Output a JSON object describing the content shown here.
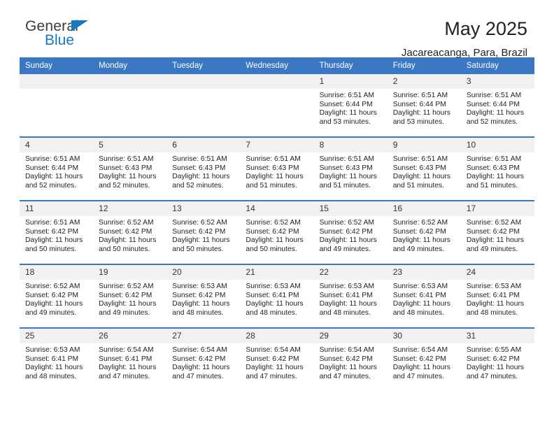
{
  "brand": {
    "name_part1": "General",
    "name_part2": "Blue",
    "flag_icon": "triangle-flag-icon",
    "accent_color": "#1878be"
  },
  "header": {
    "title": "May 2025",
    "subtitle": "Jacareacanga, Para, Brazil"
  },
  "theme": {
    "header_bg": "#3b78c3",
    "daynum_bg": "#f1f1f1",
    "row_rule": "#3b78c3",
    "text": "#232323"
  },
  "calendar": {
    "weekday_headers": [
      "Sunday",
      "Monday",
      "Tuesday",
      "Wednesday",
      "Thursday",
      "Friday",
      "Saturday"
    ],
    "weeks": [
      [
        {
          "day": "",
          "empty": true
        },
        {
          "day": "",
          "empty": true
        },
        {
          "day": "",
          "empty": true
        },
        {
          "day": "",
          "empty": true
        },
        {
          "day": "1",
          "sunrise": "Sunrise: 6:51 AM",
          "sunset": "Sunset: 6:44 PM",
          "daylight": "Daylight: 11 hours and 53 minutes."
        },
        {
          "day": "2",
          "sunrise": "Sunrise: 6:51 AM",
          "sunset": "Sunset: 6:44 PM",
          "daylight": "Daylight: 11 hours and 53 minutes."
        },
        {
          "day": "3",
          "sunrise": "Sunrise: 6:51 AM",
          "sunset": "Sunset: 6:44 PM",
          "daylight": "Daylight: 11 hours and 52 minutes."
        }
      ],
      [
        {
          "day": "4",
          "sunrise": "Sunrise: 6:51 AM",
          "sunset": "Sunset: 6:44 PM",
          "daylight": "Daylight: 11 hours and 52 minutes."
        },
        {
          "day": "5",
          "sunrise": "Sunrise: 6:51 AM",
          "sunset": "Sunset: 6:43 PM",
          "daylight": "Daylight: 11 hours and 52 minutes."
        },
        {
          "day": "6",
          "sunrise": "Sunrise: 6:51 AM",
          "sunset": "Sunset: 6:43 PM",
          "daylight": "Daylight: 11 hours and 52 minutes."
        },
        {
          "day": "7",
          "sunrise": "Sunrise: 6:51 AM",
          "sunset": "Sunset: 6:43 PM",
          "daylight": "Daylight: 11 hours and 51 minutes."
        },
        {
          "day": "8",
          "sunrise": "Sunrise: 6:51 AM",
          "sunset": "Sunset: 6:43 PM",
          "daylight": "Daylight: 11 hours and 51 minutes."
        },
        {
          "day": "9",
          "sunrise": "Sunrise: 6:51 AM",
          "sunset": "Sunset: 6:43 PM",
          "daylight": "Daylight: 11 hours and 51 minutes."
        },
        {
          "day": "10",
          "sunrise": "Sunrise: 6:51 AM",
          "sunset": "Sunset: 6:43 PM",
          "daylight": "Daylight: 11 hours and 51 minutes."
        }
      ],
      [
        {
          "day": "11",
          "sunrise": "Sunrise: 6:51 AM",
          "sunset": "Sunset: 6:42 PM",
          "daylight": "Daylight: 11 hours and 50 minutes."
        },
        {
          "day": "12",
          "sunrise": "Sunrise: 6:52 AM",
          "sunset": "Sunset: 6:42 PM",
          "daylight": "Daylight: 11 hours and 50 minutes."
        },
        {
          "day": "13",
          "sunrise": "Sunrise: 6:52 AM",
          "sunset": "Sunset: 6:42 PM",
          "daylight": "Daylight: 11 hours and 50 minutes."
        },
        {
          "day": "14",
          "sunrise": "Sunrise: 6:52 AM",
          "sunset": "Sunset: 6:42 PM",
          "daylight": "Daylight: 11 hours and 50 minutes."
        },
        {
          "day": "15",
          "sunrise": "Sunrise: 6:52 AM",
          "sunset": "Sunset: 6:42 PM",
          "daylight": "Daylight: 11 hours and 49 minutes."
        },
        {
          "day": "16",
          "sunrise": "Sunrise: 6:52 AM",
          "sunset": "Sunset: 6:42 PM",
          "daylight": "Daylight: 11 hours and 49 minutes."
        },
        {
          "day": "17",
          "sunrise": "Sunrise: 6:52 AM",
          "sunset": "Sunset: 6:42 PM",
          "daylight": "Daylight: 11 hours and 49 minutes."
        }
      ],
      [
        {
          "day": "18",
          "sunrise": "Sunrise: 6:52 AM",
          "sunset": "Sunset: 6:42 PM",
          "daylight": "Daylight: 11 hours and 49 minutes."
        },
        {
          "day": "19",
          "sunrise": "Sunrise: 6:52 AM",
          "sunset": "Sunset: 6:42 PM",
          "daylight": "Daylight: 11 hours and 49 minutes."
        },
        {
          "day": "20",
          "sunrise": "Sunrise: 6:53 AM",
          "sunset": "Sunset: 6:42 PM",
          "daylight": "Daylight: 11 hours and 48 minutes."
        },
        {
          "day": "21",
          "sunrise": "Sunrise: 6:53 AM",
          "sunset": "Sunset: 6:41 PM",
          "daylight": "Daylight: 11 hours and 48 minutes."
        },
        {
          "day": "22",
          "sunrise": "Sunrise: 6:53 AM",
          "sunset": "Sunset: 6:41 PM",
          "daylight": "Daylight: 11 hours and 48 minutes."
        },
        {
          "day": "23",
          "sunrise": "Sunrise: 6:53 AM",
          "sunset": "Sunset: 6:41 PM",
          "daylight": "Daylight: 11 hours and 48 minutes."
        },
        {
          "day": "24",
          "sunrise": "Sunrise: 6:53 AM",
          "sunset": "Sunset: 6:41 PM",
          "daylight": "Daylight: 11 hours and 48 minutes."
        }
      ],
      [
        {
          "day": "25",
          "sunrise": "Sunrise: 6:53 AM",
          "sunset": "Sunset: 6:41 PM",
          "daylight": "Daylight: 11 hours and 48 minutes."
        },
        {
          "day": "26",
          "sunrise": "Sunrise: 6:54 AM",
          "sunset": "Sunset: 6:41 PM",
          "daylight": "Daylight: 11 hours and 47 minutes."
        },
        {
          "day": "27",
          "sunrise": "Sunrise: 6:54 AM",
          "sunset": "Sunset: 6:42 PM",
          "daylight": "Daylight: 11 hours and 47 minutes."
        },
        {
          "day": "28",
          "sunrise": "Sunrise: 6:54 AM",
          "sunset": "Sunset: 6:42 PM",
          "daylight": "Daylight: 11 hours and 47 minutes."
        },
        {
          "day": "29",
          "sunrise": "Sunrise: 6:54 AM",
          "sunset": "Sunset: 6:42 PM",
          "daylight": "Daylight: 11 hours and 47 minutes."
        },
        {
          "day": "30",
          "sunrise": "Sunrise: 6:54 AM",
          "sunset": "Sunset: 6:42 PM",
          "daylight": "Daylight: 11 hours and 47 minutes."
        },
        {
          "day": "31",
          "sunrise": "Sunrise: 6:55 AM",
          "sunset": "Sunset: 6:42 PM",
          "daylight": "Daylight: 11 hours and 47 minutes."
        }
      ]
    ]
  }
}
